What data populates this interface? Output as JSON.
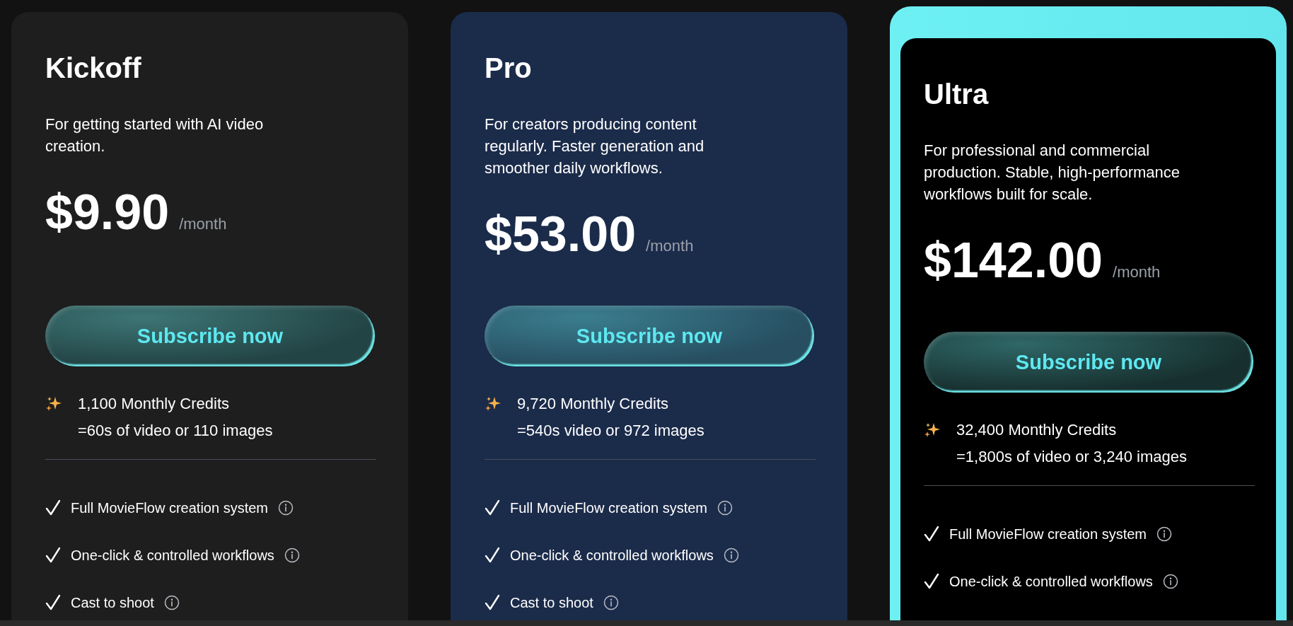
{
  "plans": [
    {
      "name": "Kickoff",
      "highlighted": false,
      "color": "#1e1e1e",
      "description": "For getting started with AI video creation.",
      "price": "$9.90",
      "period": "/month",
      "button": "Subscribe now",
      "credits": "1,100 Monthly Credits",
      "credits_detail": "=60s of video or 110 images",
      "features": [
        "Full MovieFlow creation system",
        "One-click & controlled workflows",
        "Cast to shoot"
      ]
    },
    {
      "name": "Pro",
      "highlighted": false,
      "color": "#1b2b4a",
      "description": "For creators producing content regularly. Faster generation and smoother daily workflows.",
      "price": "$53.00",
      "period": "/month",
      "button": "Subscribe now",
      "credits": "9,720 Monthly Credits",
      "credits_detail": "=540s video or 972 images",
      "features": [
        "Full MovieFlow creation system",
        "One-click & controlled workflows",
        "Cast to shoot"
      ]
    },
    {
      "name": "Ultra",
      "highlighted": true,
      "color": "#000000",
      "description": "For professional and commercial production. Stable, high-performance workflows built for scale.",
      "price": "$142.00",
      "period": "/month",
      "button": "Subscribe now",
      "credits": "32,400 Monthly Credits",
      "credits_detail": "=1,800s of video or 3,240 images",
      "features": [
        "Full MovieFlow creation system",
        "One-click & controlled workflows"
      ]
    }
  ]
}
